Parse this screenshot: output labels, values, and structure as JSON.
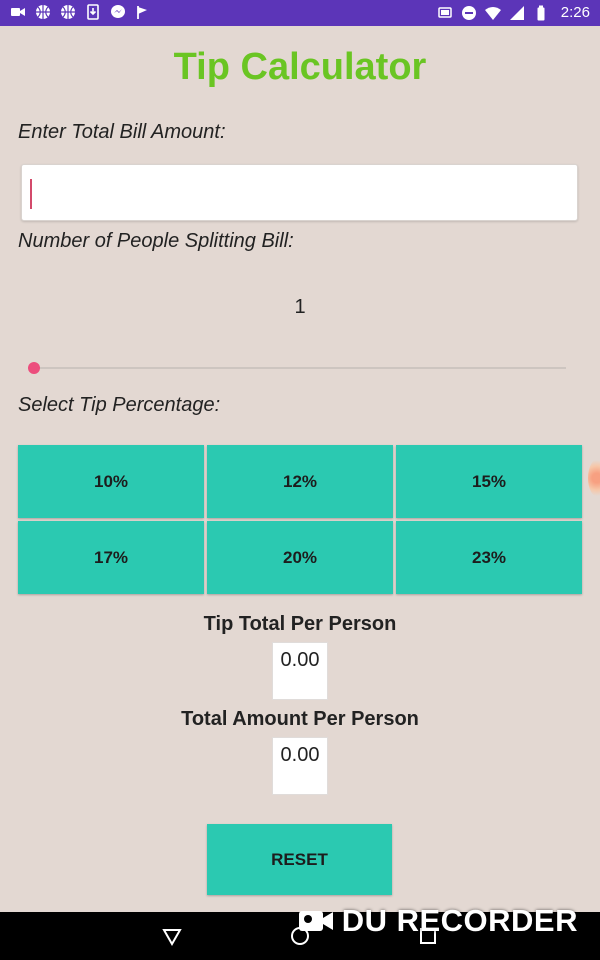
{
  "status_bar": {
    "time": "2:26",
    "left_icons": [
      "video-camera-icon",
      "basketball-icon",
      "basketball-icon",
      "download-icon",
      "messenger-icon",
      "flag-icon"
    ],
    "right_icons": [
      "cast-icon",
      "do-not-disturb-icon",
      "wifi-icon",
      "signal-icon",
      "battery-icon"
    ],
    "background_color": "#5c35b8"
  },
  "app": {
    "title": "Tip Calculator",
    "title_color": "#6ac523",
    "accent_color": "#2bc9b1",
    "slider_color": "#ec4e7d"
  },
  "bill": {
    "label": "Enter Total Bill Amount:",
    "value": ""
  },
  "people": {
    "label": "Number of People Splitting Bill:",
    "count": "1",
    "slider_level": 0
  },
  "tip": {
    "label": "Select Tip Percentage:",
    "options": [
      "10%",
      "12%",
      "15%",
      "17%",
      "20%",
      "23%"
    ]
  },
  "results": {
    "tip_label": "Tip Total Per Person",
    "tip_value": "0.00",
    "total_label": "Total Amount Per Person",
    "total_value": "0.00"
  },
  "reset_label": "RESET",
  "nav_bar": {
    "icons": [
      "back-icon",
      "home-icon",
      "recents-icon"
    ]
  },
  "watermark": {
    "text": "DU RECORDER",
    "icon": "camera-icon"
  }
}
